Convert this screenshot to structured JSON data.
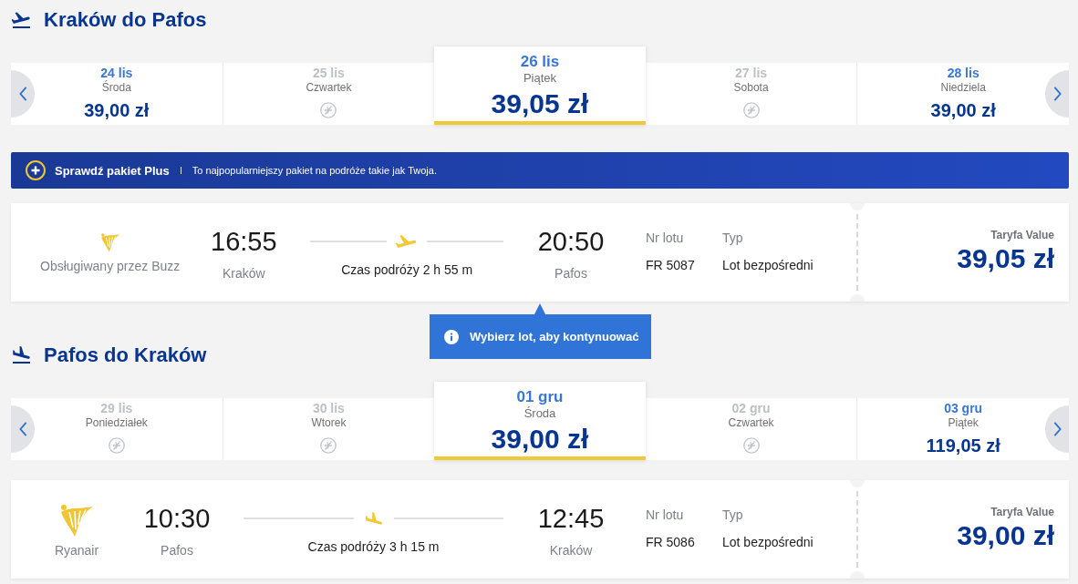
{
  "journeys": [
    {
      "kind": "outbound",
      "title": "Kraków do Pafos",
      "days": [
        {
          "date": "24 lis",
          "weekday": "Środa",
          "price": "39,00 zł",
          "available": true,
          "selected": false
        },
        {
          "date": "25 lis",
          "weekday": "Czwartek",
          "available": false,
          "selected": false
        },
        {
          "date": "26 lis",
          "weekday": "Piątek",
          "price": "39,05 zł",
          "available": true,
          "selected": true
        },
        {
          "date": "27 lis",
          "weekday": "Sobota",
          "available": false,
          "selected": false
        },
        {
          "date": "28 lis",
          "weekday": "Niedziela",
          "price": "39,00 zł",
          "available": true,
          "selected": false
        }
      ],
      "promo": {
        "title": "Sprawdź pakiet Plus",
        "text": "To najpopularniejszy pakiet na podróże takie jak Twoja."
      },
      "flight": {
        "operator": "Obsługiwany przez Buzz",
        "partner": true,
        "departure_time": "16:55",
        "departure_city": "Kraków",
        "duration": "Czas podróży 2 h 55 m",
        "arrival_time": "20:50",
        "arrival_city": "Pafos",
        "flight_number_label": "Nr lotu",
        "flight_number": "FR 5087",
        "type_label": "Typ",
        "type": "Lot bezpośredni",
        "fare_label": "Taryfa Value",
        "fare_price": "39,05 zł"
      },
      "hint": "Wybierz lot, aby kontynuować"
    },
    {
      "kind": "inbound",
      "title": "Pafos do Kraków",
      "days": [
        {
          "date": "29 lis",
          "weekday": "Poniedziałek",
          "available": false,
          "selected": false
        },
        {
          "date": "30 lis",
          "weekday": "Wtorek",
          "available": false,
          "selected": false
        },
        {
          "date": "01 gru",
          "weekday": "Środa",
          "price": "39,00 zł",
          "available": true,
          "selected": true
        },
        {
          "date": "02 gru",
          "weekday": "Czwartek",
          "available": false,
          "selected": false
        },
        {
          "date": "03 gru",
          "weekday": "Piątek",
          "price": "119,05 zł",
          "available": true,
          "selected": false
        }
      ],
      "flight": {
        "operator": "Ryanair",
        "partner": false,
        "departure_time": "10:30",
        "departure_city": "Pafos",
        "duration": "Czas podróży 3 h 15 m",
        "arrival_time": "12:45",
        "arrival_city": "Kraków",
        "flight_number_label": "Nr lotu",
        "flight_number": "FR 5086",
        "type_label": "Typ",
        "type": "Lot bezpośredni",
        "fare_label": "Taryfa Value",
        "fare_price": "39,00 zł"
      }
    }
  ]
}
